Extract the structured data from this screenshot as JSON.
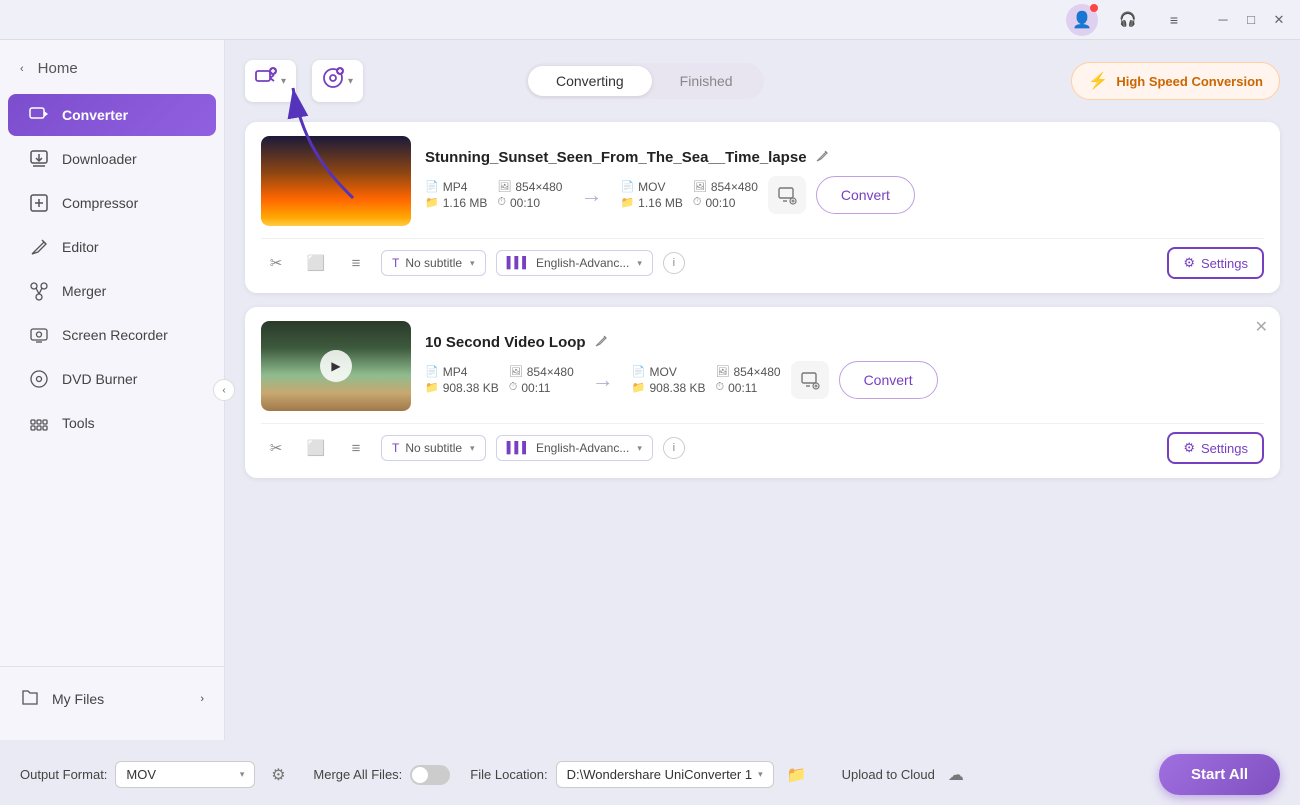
{
  "titlebar": {
    "minimize_label": "─",
    "maximize_label": "□",
    "close_label": "✕"
  },
  "sidebar": {
    "home_label": "Home",
    "items": [
      {
        "id": "converter",
        "label": "Converter",
        "icon": "📹",
        "active": true
      },
      {
        "id": "downloader",
        "label": "Downloader",
        "icon": "⬇"
      },
      {
        "id": "compressor",
        "label": "Compressor",
        "icon": "🗜"
      },
      {
        "id": "editor",
        "label": "Editor",
        "icon": "✂"
      },
      {
        "id": "merger",
        "label": "Merger",
        "icon": "🔗"
      },
      {
        "id": "screen-recorder",
        "label": "Screen Recorder",
        "icon": "📷"
      },
      {
        "id": "dvd-burner",
        "label": "DVD Burner",
        "icon": "💿"
      },
      {
        "id": "tools",
        "label": "Tools",
        "icon": "⚙"
      }
    ],
    "my_files_label": "My Files"
  },
  "toolbar": {
    "add_file_label": "Add File",
    "add_media_label": "Add Media",
    "tab_converting": "Converting",
    "tab_finished": "Finished",
    "high_speed_label": "High Speed Conversion"
  },
  "videos": [
    {
      "id": "video1",
      "title": "Stunning_Sunset_Seen_From_The_Sea__Time_lapse",
      "src_format": "MP4",
      "src_resolution": "854×480",
      "src_size": "1.16 MB",
      "src_duration": "00:10",
      "dst_format": "MOV",
      "dst_resolution": "854×480",
      "dst_size": "1.16 MB",
      "dst_duration": "00:10",
      "subtitle": "No subtitle",
      "audio": "English-Advanc...",
      "convert_label": "Convert",
      "settings_label": "Settings",
      "type": "sunset"
    },
    {
      "id": "video2",
      "title": "10 Second Video Loop",
      "src_format": "MP4",
      "src_resolution": "854×480",
      "src_size": "908.38 KB",
      "src_duration": "00:11",
      "dst_format": "MOV",
      "dst_resolution": "854×480",
      "dst_size": "908.38 KB",
      "dst_duration": "00:11",
      "subtitle": "No subtitle",
      "audio": "English-Advanc...",
      "convert_label": "Convert",
      "settings_label": "Settings",
      "type": "loop"
    }
  ],
  "bottom": {
    "output_format_label": "Output Format:",
    "output_format_value": "MOV",
    "file_location_label": "File Location:",
    "file_location_value": "D:\\Wondershare UniConverter 1",
    "merge_label": "Merge All Files:",
    "upload_label": "Upload to Cloud",
    "start_all_label": "Start All"
  },
  "colors": {
    "accent": "#7740c0",
    "accent_light": "#a070e0",
    "high_speed_orange": "#ff8c00"
  }
}
